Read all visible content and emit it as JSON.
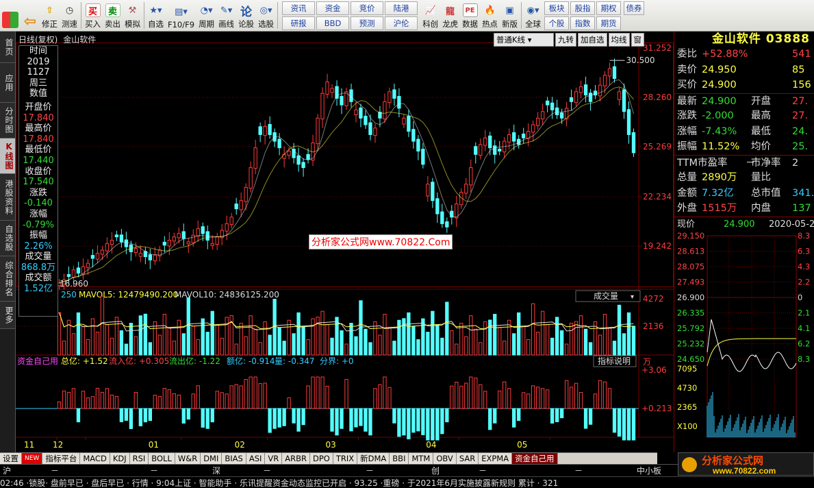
{
  "toolbar": {
    "left_buttons": [
      {
        "label": "",
        "icon": "windows-icon"
      },
      {
        "label": "",
        "icon": "back-icon"
      },
      {
        "label": "修正",
        "icon": "up-arrow-icon"
      },
      {
        "label": "测速",
        "icon": "clock-icon"
      },
      {
        "label": "买入",
        "icon": "buy-icon",
        "glyph": "买"
      },
      {
        "label": "卖出",
        "icon": "sell-icon",
        "glyph": "卖"
      },
      {
        "label": "模拟",
        "icon": "hammer-icon"
      },
      {
        "label": "自选",
        "icon": "star-icon"
      },
      {
        "label": "F10/F9",
        "icon": "f10-icon"
      },
      {
        "label": "周期",
        "icon": "cycle-icon"
      },
      {
        "label": "画线",
        "icon": "pencil-icon"
      },
      {
        "label": "论股",
        "icon": "forum-icon",
        "glyph": "论"
      },
      {
        "label": "选股",
        "icon": "select-stock-icon"
      }
    ],
    "grid_buttons": [
      [
        "资讯",
        "资金",
        "竞价",
        "陆港"
      ],
      [
        "研报",
        "BBD",
        "预测",
        "沪伦"
      ]
    ],
    "right_buttons": [
      {
        "label": "科创",
        "icon": "kechuang-icon"
      },
      {
        "label": "龙虎",
        "icon": "dragon-tiger-icon"
      },
      {
        "label": "数据",
        "icon": "data-icon",
        "glyph": "PE"
      },
      {
        "label": "热点",
        "icon": "hot-icon"
      },
      {
        "label": "新版",
        "icon": "newversion-icon"
      },
      {
        "label": "全球",
        "icon": "globe-icon"
      }
    ],
    "grid2_buttons": [
      [
        "板块",
        "股指",
        "期权"
      ],
      [
        "个股",
        "指数",
        "期货"
      ]
    ],
    "extra": "债券"
  },
  "left_tabs": [
    {
      "label": "首页",
      "active": false
    },
    {
      "label": "应用",
      "active": false
    },
    {
      "label": "分时图",
      "active": false
    },
    {
      "label": "K线图",
      "active": true
    },
    {
      "label": "港股资料",
      "active": false
    },
    {
      "label": "自选股",
      "active": false
    },
    {
      "label": "综合排名",
      "active": false
    },
    {
      "label": "更多",
      "active": false
    }
  ],
  "chart_header": {
    "title": "日线(复权)",
    "name": "金山软件",
    "kline_type": "普通K线",
    "buttons": [
      "九转",
      "加自选",
      "均线",
      "窗"
    ]
  },
  "info_box": {
    "time_label": "时间",
    "year": "2019",
    "date": "1127",
    "weekday": "周三",
    "value_label": "数值",
    "open_label": "开盘价",
    "open": "17.840",
    "high_label": "最高价",
    "high": "17.840",
    "low_label": "最低价",
    "low": "17.440",
    "close_label": "收盘价",
    "close": "17.540",
    "change_label": "涨跌",
    "change": "-0.140",
    "pct_label": "涨幅",
    "pct": "-0.79%",
    "amp_label": "振幅",
    "amp": "2.26%",
    "vol_label": "成交量",
    "vol": "868.8万",
    "amt_label": "成交额",
    "amt": "1.52亿"
  },
  "price_axis": [
    "31.252",
    "28.260",
    "25.269",
    "22.234",
    "19.242"
  ],
  "price_annotations": {
    "high": "30.500",
    "low": "16.960"
  },
  "volume_header": {
    "prefix": "250",
    "mavol5": "MAVOL5: 12479490.200",
    "mavol10": "MAVOL10: 24836125.200",
    "selector": "成交量"
  },
  "volume_axis": [
    "4272",
    "2136",
    "万"
  ],
  "flow_header": {
    "name": "资金自己用",
    "total": "总亿: +1.52",
    "inflow": "流入亿: +0.305",
    "outflow": "流出亿: -1.22",
    "amount": "额亿: -0.914",
    "qty": "量: -0.347",
    "split": "分界: +0",
    "help": "指标说明"
  },
  "flow_axis": [
    "+3.06",
    "+0.213"
  ],
  "x_axis": [
    "11",
    "12",
    "01",
    "02",
    "03",
    "04",
    "05"
  ],
  "watermark": "分析家公式网www.70822.Com",
  "right_panel": {
    "title": "金山软件 03888",
    "rows": [
      {
        "l1": "委比",
        "v1": "+52.88%",
        "c1": "#ff4444",
        "l2": "",
        "v2": "541",
        "c2": "#ff4444"
      },
      {
        "l1": "卖价",
        "v1": "24.950",
        "c1": "#ffff44",
        "l2": "",
        "v2": "85",
        "c2": "#ffff44"
      },
      {
        "l1": "买价",
        "v1": "24.900",
        "c1": "#ffff44",
        "l2": "",
        "v2": "156",
        "c2": "#ffff44"
      },
      {
        "l1": "最新",
        "v1": "24.900",
        "c1": "#33dd33",
        "l2": "开盘",
        "v2": "27.",
        "c2": "#ff4444"
      },
      {
        "l1": "涨跌",
        "v1": "-2.000",
        "c1": "#33dd33",
        "l2": "最高",
        "v2": "27.",
        "c2": "#ff4444"
      },
      {
        "l1": "涨幅",
        "v1": "-7.43%",
        "c1": "#33dd33",
        "l2": "最低",
        "v2": "24.",
        "c2": "#33dd33"
      },
      {
        "l1": "振幅",
        "v1": "11.52%",
        "c1": "#ffff44",
        "l2": "均价",
        "v2": "25.",
        "c2": "#33dd33"
      },
      {
        "l1": "TTM市盈率",
        "v1": "－",
        "c1": "#ddd",
        "l2": "市净率",
        "v2": "2",
        "c2": "#ddd"
      },
      {
        "l1": "总量",
        "v1": "2890万",
        "c1": "#ffff44",
        "l2": "量比",
        "v2": "",
        "c2": "#ddd"
      },
      {
        "l1": "金额",
        "v1": "7.32亿",
        "c1": "#3cf",
        "l2": "总市值",
        "v2": "341.",
        "c2": "#3cf"
      },
      {
        "l1": "外盘",
        "v1": "1515万",
        "c1": "#ff4444",
        "l2": "内盘",
        "v2": "137",
        "c2": "#33dd33"
      }
    ],
    "now_label": "现价",
    "now_price": "24.900",
    "now_date": "2020-05-2",
    "mini_axis_left": [
      "29.150",
      "28.613",
      "28.075",
      "27.493",
      "26.900",
      "26.335",
      "25.792",
      "25.232",
      "24.650"
    ],
    "mini_axis_right": [
      "8.3",
      "6.3",
      "4.3",
      "2.2",
      "0",
      "2.1",
      "4.1",
      "6.2",
      "8.3"
    ],
    "vol_axis": [
      "7095",
      "4730",
      "2365",
      "X100"
    ]
  },
  "bottom_tabs": [
    "设置",
    "NEW",
    "指标平台",
    "MACD",
    "KDJ",
    "RSI",
    "BOLL",
    "W&R",
    "DMI",
    "BIAS",
    "ASI",
    "VR",
    "ARBR",
    "DPO",
    "TRIX",
    "新DMA",
    "BBI",
    "MTM",
    "OBV",
    "SAR",
    "EXPMA",
    "资金自己用"
  ],
  "active_tab": "资金自己用",
  "status_bar": [
    "沪",
    "－",
    "－",
    "深",
    "－",
    "－",
    "创",
    "－",
    "－",
    "中小板"
  ],
  "ticker_text": "02:46 ·锁股· 盘前早已 · 盘后早已 · 行情 · 9:04上证 · 智能助手 · 乐讯提醒资金动态监控已开启  · 93.25 ·重磅 · 于2021年6月实施披露新规则 累计 · 321",
  "logo": {
    "text": "分析家公式网",
    "url": "www.70822.com"
  },
  "chart_data": [
    {
      "type": "candlestick",
      "title": "日线(复权)",
      "x": [
        "11",
        "12",
        "01",
        "02",
        "03",
        "04",
        "05"
      ],
      "ylim": [
        16.96,
        31.252
      ],
      "series_note": "daily OHLC candles from late Nov 2019 to late May 2020",
      "closes": [
        17.0,
        17.2,
        17.4,
        17.8,
        17.6,
        18.0,
        18.2,
        18.5,
        18.8,
        19.0,
        19.4,
        19.6,
        19.8,
        19.5,
        19.2,
        18.9,
        19.1,
        18.8,
        18.6,
        18.4,
        18.7,
        19.0,
        19.3,
        19.6,
        19.8,
        20.0,
        19.7,
        19.5,
        19.9,
        20.3,
        20.0,
        19.6,
        19.4,
        19.8,
        20.2,
        20.6,
        21.0,
        21.5,
        22.0,
        22.8,
        24.0,
        25.2,
        26.0,
        26.5,
        26.0,
        25.6,
        25.2,
        24.8,
        25.0,
        24.6,
        24.2,
        24.0,
        24.5,
        25.5,
        27.0,
        28.5,
        29.2,
        28.8,
        28.2,
        27.8,
        28.6,
        28.0,
        27.5,
        27.0,
        26.6,
        26.0,
        26.4,
        27.0,
        28.0,
        28.6,
        28.2,
        27.6,
        27.0,
        26.2,
        25.6,
        25.0,
        24.2,
        23.0,
        22.0,
        21.2,
        20.6,
        20.4,
        21.0,
        21.8,
        22.5,
        23.0,
        24.0,
        24.8,
        25.4,
        25.8,
        25.2,
        24.8,
        25.0,
        25.6,
        26.0,
        25.6,
        25.4,
        25.8,
        26.2,
        26.6,
        27.0,
        27.4,
        27.8,
        27.5,
        27.2,
        27.0,
        27.6,
        28.0,
        28.6,
        28.9,
        28.4,
        28.0,
        28.4,
        29.0,
        29.6,
        30.0,
        29.4,
        28.6,
        27.4,
        26.0,
        24.9
      ],
      "ma_note": "moving average lines overlaid"
    },
    {
      "type": "bar",
      "title": "成交量",
      "series": [
        {
          "name": "MAVOL5",
          "last": 12479490.2
        },
        {
          "name": "MAVOL10",
          "last": 24836125.2
        }
      ],
      "ylim": [
        0,
        4272
      ],
      "unit": "万"
    },
    {
      "type": "bar",
      "title": "资金自己用",
      "ylim": [
        -3.06,
        3.06
      ]
    }
  ],
  "colors": {
    "up": "#ff3b3b",
    "down": "#54ffff",
    "grid": "#7a0000",
    "bg": "#000000",
    "accent_yellow": "#ffff44"
  }
}
